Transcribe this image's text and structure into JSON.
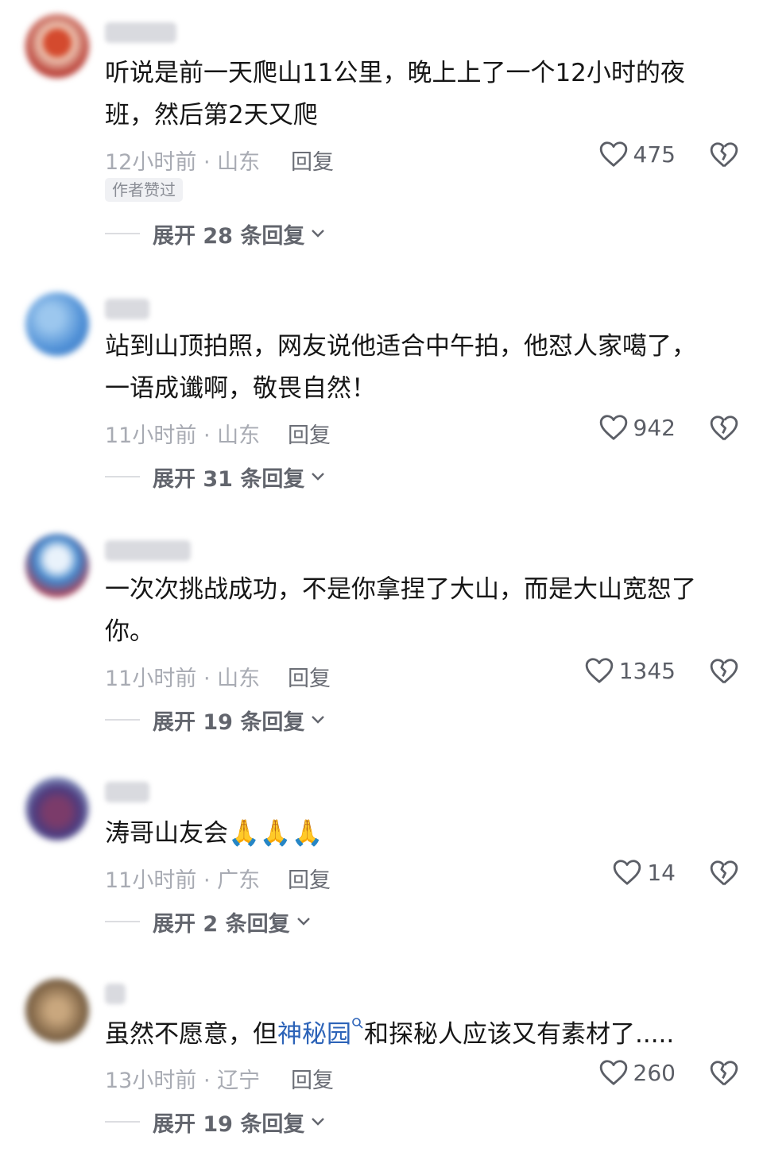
{
  "comments": [
    {
      "text": "听说是前一天爬山11公里，晚上上了一个12小时的夜班，然后第2天又爬",
      "time": "12小时前 · 山东",
      "reply": "回复",
      "likes": "475",
      "badge": "作者赞过",
      "expand": "展开 28 条回复"
    },
    {
      "text": "站到山顶拍照，网友说他适合中午拍，他怼人家噶了，一语成谶啊，敬畏自然！",
      "time": "11小时前 · 山东",
      "reply": "回复",
      "likes": "942",
      "expand": "展开 31 条回复"
    },
    {
      "text": "一次次挑战成功，不是你拿捏了大山，而是大山宽恕了你。",
      "time": "11小时前 · 山东",
      "reply": "回复",
      "likes": "1345",
      "expand": "展开 19 条回复"
    },
    {
      "text": "涛哥山友会",
      "emoji": "🙏🙏🙏",
      "time": "11小时前 · 广东",
      "reply": "回复",
      "likes": "14",
      "expand": "展开 2 条回复"
    },
    {
      "text_before": "虽然不愿意，但",
      "link": "神秘园",
      "text_after": "和探秘人应该又有素材了.....",
      "time": "13小时前 · 辽宁",
      "reply": "回复",
      "likes": "260",
      "expand": "展开 19 条回复"
    }
  ],
  "colors": {
    "link": "#2c63b8",
    "meta": "#a8abb3",
    "text": "#161616"
  }
}
